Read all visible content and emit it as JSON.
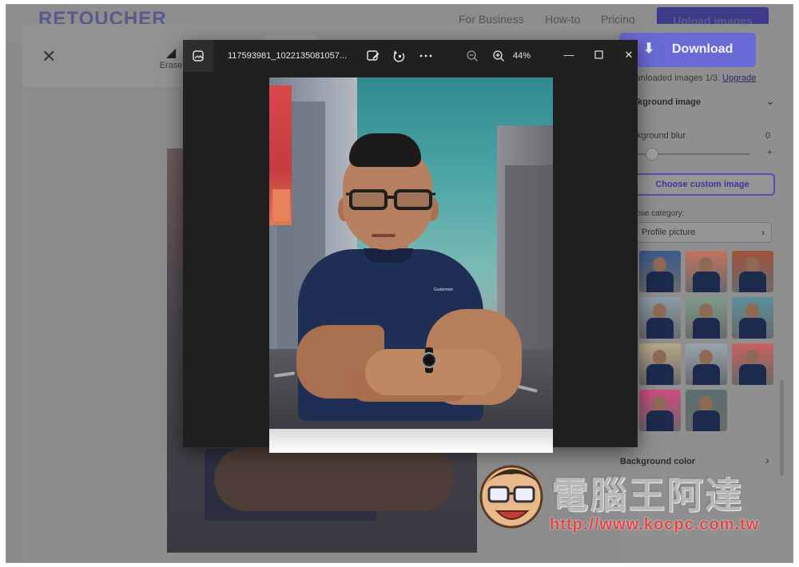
{
  "site": {
    "logo": "RETOUCHER",
    "nav": [
      "For Business",
      "How-to",
      "Pricing"
    ],
    "upload_label": "Upload images"
  },
  "editor": {
    "close": "✕",
    "erase_label": "Erase"
  },
  "panel": {
    "download_label": "Download",
    "download_note": "Downloaded images 1/3.",
    "upgrade_label": "Upgrade",
    "bg_image_title": "Background image",
    "bg_blur_label": "Background blur",
    "bg_blur_value": "0",
    "custom_image_label": "Choose custom image",
    "category_label": "Choose category:",
    "category_value": "Profile picture",
    "bg_color_title": "Background color",
    "thumb_colors": [
      "#3d5a8a",
      "#c2735e",
      "#a0523c",
      "#8c9aa8",
      "#7f9a8a",
      "#5a8f9a",
      "#b7a88a",
      "#9aa4ae",
      "#c86060",
      "#d04a80",
      "#5a6e70"
    ]
  },
  "viewer": {
    "filename": "117593981_1022135081057...",
    "zoom": "44%",
    "tools": [
      "edit-image-icon",
      "rotate-icon",
      "more-icon",
      "zoom-out-icon",
      "zoom-in-icon"
    ]
  },
  "photo": {
    "shirt_logo": "Gustomize"
  },
  "watermark": {
    "chinese": "電腦王阿達",
    "url": "http://www.kocpc.com.tw"
  },
  "colors": {
    "accent": "#5b4ab8",
    "viewer_bg": "#1f1f1f"
  }
}
